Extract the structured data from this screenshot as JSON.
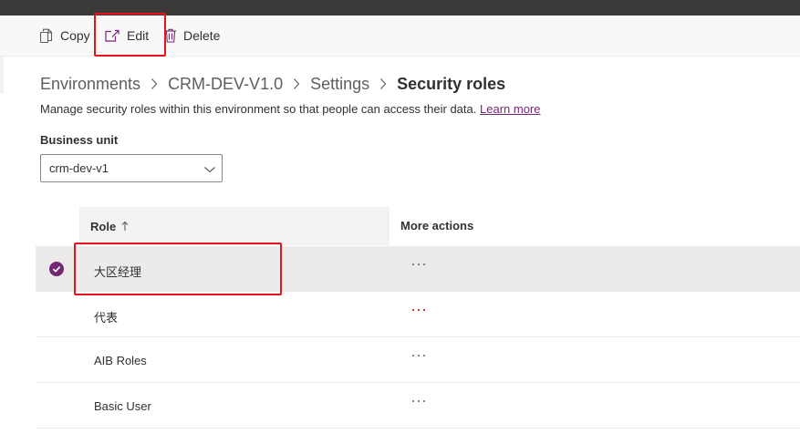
{
  "commands": {
    "copy_label": "Copy",
    "edit_label": "Edit",
    "delete_label": "Delete"
  },
  "breadcrumb": {
    "items": [
      "Environments",
      "CRM-DEV-V1.0",
      "Settings"
    ],
    "current": "Security roles"
  },
  "description": {
    "text": "Manage security roles within this environment so that people can access their data.",
    "link": "Learn more"
  },
  "business_unit": {
    "label": "Business unit",
    "value": "crm-dev-v1"
  },
  "table": {
    "columns": [
      "Role",
      "More actions"
    ],
    "sort_indicator": "↑",
    "rows": [
      {
        "name": "大区经理",
        "selected": true,
        "more": "···"
      },
      {
        "name": "代表",
        "selected": false,
        "more": "···"
      },
      {
        "name": "AIB Roles",
        "selected": false,
        "more": "···"
      },
      {
        "name": "Basic User",
        "selected": false,
        "more": "···"
      }
    ]
  },
  "colors": {
    "accent": "#742774",
    "highlight": "#e8141b",
    "topbar": "#3b3a39",
    "selected_row": "#edebe9"
  }
}
